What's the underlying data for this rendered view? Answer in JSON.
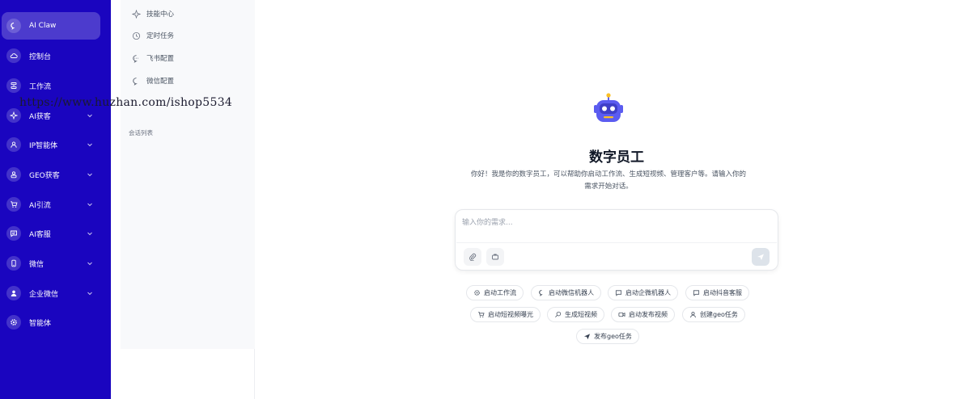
{
  "sidebar": {
    "items": [
      {
        "label": "AI Claw",
        "icon": "chat-bubble-icon",
        "active": true,
        "expandable": false
      },
      {
        "label": "控制台",
        "icon": "cloud-icon",
        "active": false,
        "expandable": false
      },
      {
        "label": "工作流",
        "icon": "workflow-icon",
        "active": false,
        "expandable": false
      },
      {
        "label": "AI获客",
        "icon": "sparkle-icon",
        "active": false,
        "expandable": true
      },
      {
        "label": "IP智能体",
        "icon": "user-icon",
        "active": false,
        "expandable": true
      },
      {
        "label": "GEO获客",
        "icon": "user-badge-icon",
        "active": false,
        "expandable": true
      },
      {
        "label": "AI引流",
        "icon": "cart-icon",
        "active": false,
        "expandable": true
      },
      {
        "label": "AI客服",
        "icon": "message-square-icon",
        "active": false,
        "expandable": true
      },
      {
        "label": "微信",
        "icon": "phone-icon",
        "active": false,
        "expandable": true
      },
      {
        "label": "企业微信",
        "icon": "person-icon",
        "active": false,
        "expandable": true
      },
      {
        "label": "智能体",
        "icon": "gear-icon",
        "active": false,
        "expandable": false
      }
    ]
  },
  "panel": {
    "menu": [
      {
        "label": "技能中心",
        "icon": "sparkle-icon"
      },
      {
        "label": "定时任务",
        "icon": "clock-icon"
      },
      {
        "label": "飞书配置",
        "icon": "chat-dots-icon"
      },
      {
        "label": "微信配置",
        "icon": "chat-bubble-icon"
      }
    ],
    "section_title": "会话列表"
  },
  "watermark": "https://www.huzhan.com/ishop5534",
  "main": {
    "title": "数字员工",
    "subtitle_line1": "你好！我是你的数字员工，可以帮助你启动工作流、生成短视频、管理客户等。请输入你的",
    "subtitle_line2": "需求开始对话。",
    "input_placeholder": "输入你的需求...",
    "chips": [
      {
        "label": "启动工作流",
        "icon": "gear-icon"
      },
      {
        "label": "启动微信机器人",
        "icon": "chat-bubble-icon"
      },
      {
        "label": "启动企微机器人",
        "icon": "message-square-icon"
      },
      {
        "label": "启动抖音客服",
        "icon": "message-square-icon"
      },
      {
        "label": "启动短视频曝光",
        "icon": "cart-icon"
      },
      {
        "label": "生成短视频",
        "icon": "search-icon"
      },
      {
        "label": "启动发布视频",
        "icon": "video-icon"
      },
      {
        "label": "创建geo任务",
        "icon": "user-icon"
      },
      {
        "label": "发布geo任务",
        "icon": "send-icon"
      }
    ]
  },
  "colors": {
    "sidebar_bg": "#1a05bf",
    "robot": "#5b5cf0",
    "robot_accent": "#fbbf24"
  }
}
